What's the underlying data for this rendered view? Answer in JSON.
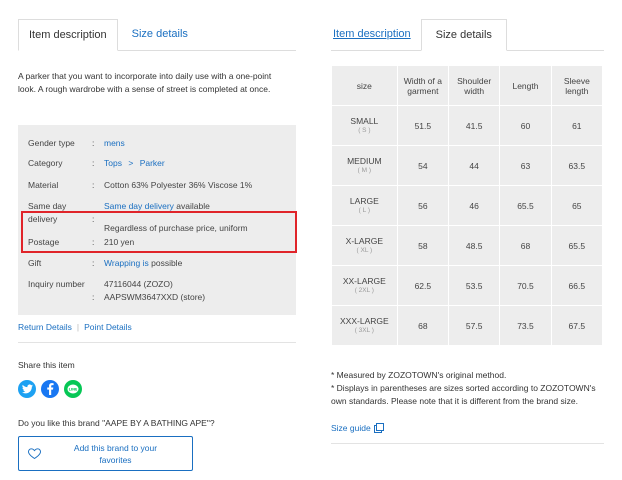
{
  "left_tabs": {
    "active": "Item description",
    "other": "Size details"
  },
  "right_tabs": {
    "other": "Item description",
    "active": "Size details"
  },
  "description": "A parker that you want to incorporate into daily use with a one-point look. A rough wardrobe with a sense of street is completed at once.",
  "specs": {
    "gender_key": "Gender type",
    "gender_val": "mens",
    "category_key": "Category",
    "category_1": "Tops",
    "category_sep": ">",
    "category_2": "Parker",
    "material_key": "Material",
    "material_val": "Cotton 63% Polyester 36% Viscose 1%",
    "sameday_key": "Same day",
    "sameday_link": "Same day delivery",
    "sameday_tail": "available",
    "delivery_key": "delivery",
    "postage_note": "Regardless of purchase price, uniform",
    "postage_key": "Postage",
    "postage_val": "210 yen",
    "gift_key": "Gift",
    "gift_link": "Wrapping is",
    "gift_tail": "possible",
    "inquiry_key": "Inquiry number",
    "inquiry_val1": "47116044 (ZOZO)",
    "inquiry_val2": "AAPSWM3647XXD (store)",
    "colon": ":"
  },
  "links": {
    "return": "Return Details",
    "point": "Point Details"
  },
  "share": {
    "title": "Share this item"
  },
  "brand": {
    "question": "Do you like this brand \"AAPE BY A BATHING APE\"?",
    "button_line1": "Add this brand to your",
    "button_line2": "favorites"
  },
  "size_table": {
    "headers": [
      "size",
      "Width of a garment",
      "Shoulder width",
      "Length",
      "Sleeve length"
    ],
    "rows": [
      {
        "size": "SMALL",
        "sub": "( S )",
        "vals": [
          "51.5",
          "41.5",
          "60",
          "61"
        ]
      },
      {
        "size": "MEDIUM",
        "sub": "( M )",
        "vals": [
          "54",
          "44",
          "63",
          "63.5"
        ]
      },
      {
        "size": "LARGE",
        "sub": "( L )",
        "vals": [
          "56",
          "46",
          "65.5",
          "65"
        ]
      },
      {
        "size": "X-LARGE",
        "sub": "( XL )",
        "vals": [
          "58",
          "48.5",
          "68",
          "65.5"
        ]
      },
      {
        "size": "XX-LARGE",
        "sub": "( 2XL )",
        "vals": [
          "62.5",
          "53.5",
          "70.5",
          "66.5"
        ]
      },
      {
        "size": "XXX-LARGE",
        "sub": "( 3XL )",
        "vals": [
          "68",
          "57.5",
          "73.5",
          "67.5"
        ]
      }
    ]
  },
  "notes": {
    "n1": "* Measured by ZOZOTOWN's original method.",
    "n2": "* Displays in parentheses are sizes sorted according to ZOZOTOWN's own standards. Please note that it is different from the brand size.",
    "size_guide": "Size guide"
  },
  "colors": {
    "link": "#1a6fc1",
    "highlight": "#e0242a",
    "twitter": "#1da1f2",
    "facebook": "#1877f2",
    "line": "#06c755"
  },
  "icons": [
    "twitter-icon",
    "facebook-icon",
    "line-icon",
    "heart-icon",
    "external-link-icon"
  ]
}
